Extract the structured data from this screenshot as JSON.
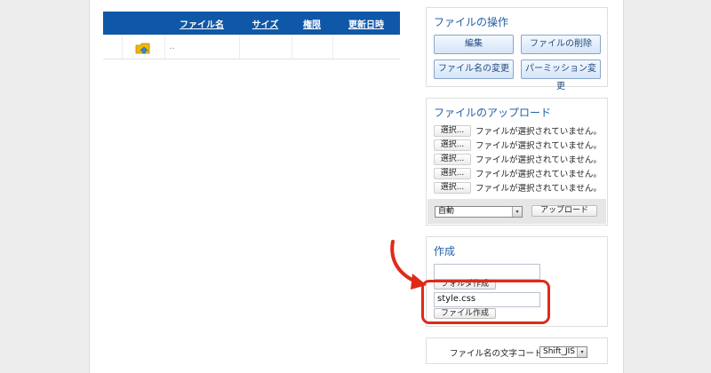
{
  "file_table": {
    "columns": [
      "",
      "",
      "ファイル名",
      "サイズ",
      "権限",
      "更新日時"
    ],
    "rows": [
      {
        "icon": "up-directory-icon",
        "name": ".."
      }
    ]
  },
  "file_ops": {
    "title": "ファイルの操作",
    "buttons": [
      "編集",
      "ファイルの削除",
      "ファイル名の変更",
      "パーミッション変更"
    ]
  },
  "upload": {
    "title": "ファイルのアップロード",
    "pick_label": "選択...",
    "rows": [
      "ファイルが選択されていません。",
      "ファイルが選択されていません。",
      "ファイルが選択されていません。",
      "ファイルが選択されていません。",
      "ファイルが選択されていません。"
    ],
    "mode_value": "自動",
    "upload_button": "アップロード"
  },
  "create": {
    "title": "作成",
    "folder_input_value": "",
    "folder_button": "フォルダ作成",
    "file_input_value": "style.css",
    "file_button": "ファイル作成"
  },
  "encoding": {
    "label": "ファイル名の文字コード：",
    "value": "Shift_JIS"
  },
  "colors": {
    "header_blue": "#0f57a7",
    "panel_title": "#2261a8",
    "annotation_red": "#e02a19"
  }
}
